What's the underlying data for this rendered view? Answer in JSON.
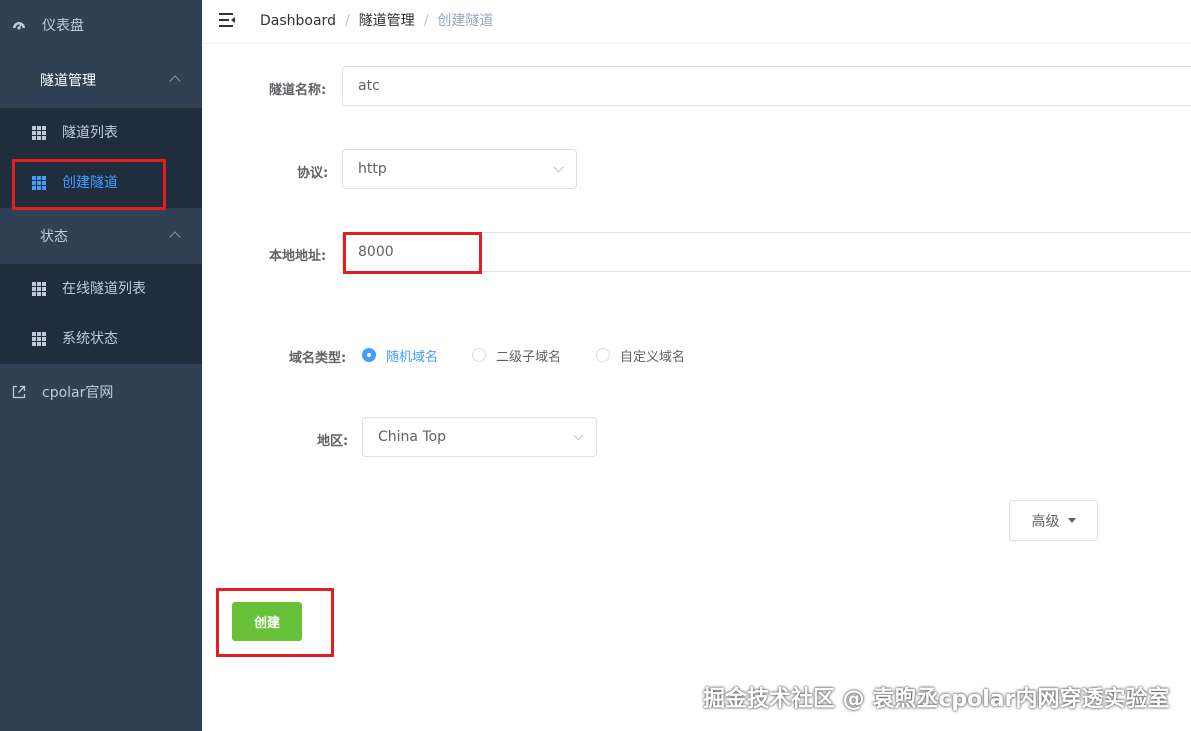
{
  "sidebar": {
    "dashboard": {
      "label": "仪表盘",
      "icon": "dashboard-icon"
    },
    "tunnel_mgmt": {
      "label": "隧道管理",
      "icon": "circle-icon",
      "children": [
        {
          "label": "隧道列表",
          "icon": "grid-icon"
        },
        {
          "label": "创建隧道",
          "icon": "grid-icon",
          "active": true
        }
      ]
    },
    "status": {
      "label": "状态",
      "icon": "circle-icon",
      "children": [
        {
          "label": "在线隧道列表",
          "icon": "grid-icon"
        },
        {
          "label": "系统状态",
          "icon": "grid-icon"
        }
      ]
    },
    "website": {
      "label": "cpolar官网",
      "icon": "external-link-icon"
    }
  },
  "header": {
    "menu_icon": "menu-fold-icon",
    "breadcrumb": [
      "Dashboard",
      "隧道管理",
      "创建隧道"
    ]
  },
  "form": {
    "tunnel_name": {
      "label": "隧道名称:",
      "value": "atc"
    },
    "protocol": {
      "label": "协议:",
      "value": "http"
    },
    "local_address": {
      "label": "本地地址:",
      "value": "8000"
    },
    "domain_type": {
      "label": "域名类型:",
      "options": [
        "随机域名",
        "二级子域名",
        "自定义域名"
      ],
      "selected": "随机域名"
    },
    "region": {
      "label": "地区:",
      "value": "China Top"
    },
    "advanced_label": "高级",
    "create_label": "创建"
  },
  "colors": {
    "sidebar_bg": "#304156",
    "submenu_bg": "#1f2d3d",
    "active": "#409eff",
    "create_button": "#67c23a",
    "highlight_box": "#e02020"
  },
  "watermark": "掘金技术社区 @ 袁煦丞cpolar内网穿透实验室"
}
